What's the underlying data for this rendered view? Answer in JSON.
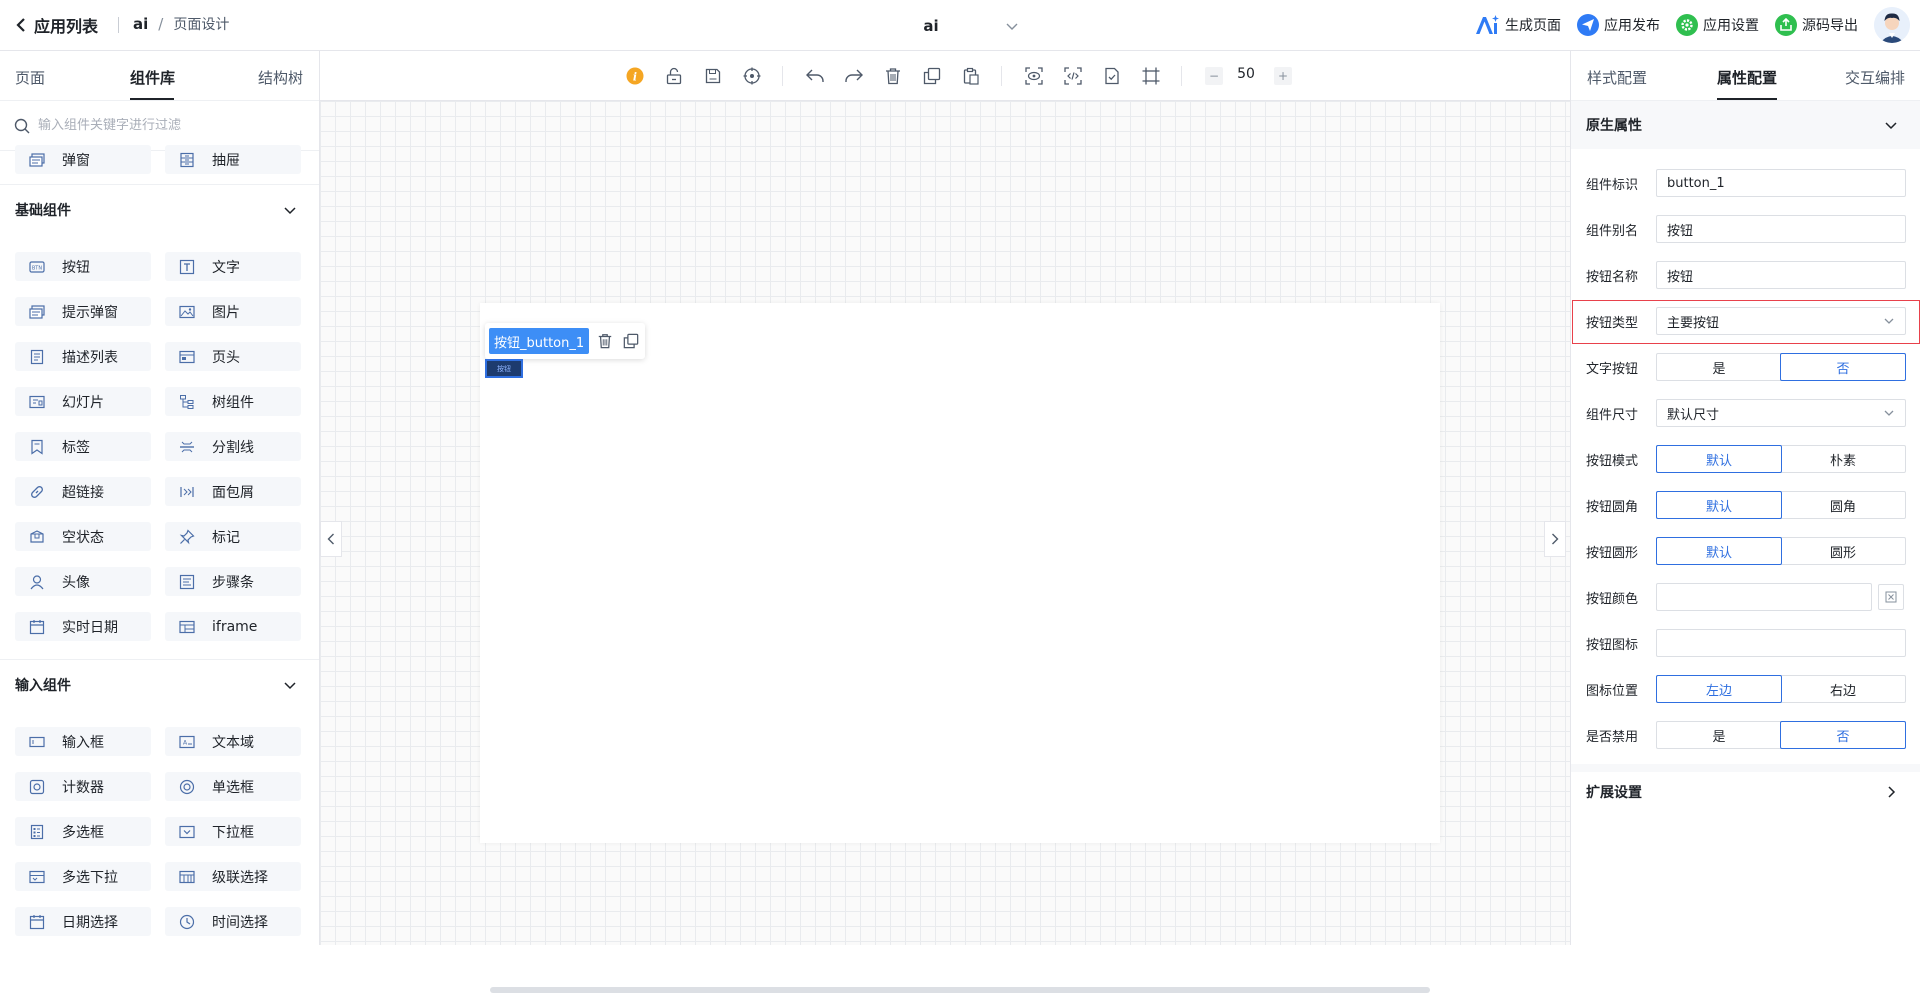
{
  "header": {
    "back_label": "应用列表",
    "app_name": "ai",
    "separator": "/",
    "page_label": "页面设计",
    "current_page": "ai",
    "actions": [
      {
        "label": "生成页面",
        "icon": "ai-icon"
      },
      {
        "label": "应用发布",
        "icon": "send-icon",
        "color": "#2f7bf5"
      },
      {
        "label": "应用设置",
        "icon": "settings-icon",
        "color": "#2fbf4f"
      },
      {
        "label": "源码导出",
        "icon": "export-icon",
        "color": "#2fbf4f"
      }
    ]
  },
  "left_panel": {
    "tabs": [
      "页面",
      "组件库",
      "结构树"
    ],
    "active_tab": "组件库",
    "search_placeholder": "输入组件关键字进行过滤",
    "top_items": [
      {
        "label": "弹窗",
        "icon": "modal-icon"
      },
      {
        "label": "抽屉",
        "icon": "drawer-icon"
      }
    ],
    "groups": [
      {
        "title": "基础组件",
        "items": [
          {
            "label": "按钮",
            "icon": "button-icon"
          },
          {
            "label": "文字",
            "icon": "text-icon"
          },
          {
            "label": "提示弹窗",
            "icon": "toast-icon"
          },
          {
            "label": "图片",
            "icon": "image-icon"
          },
          {
            "label": "描述列表",
            "icon": "description-icon"
          },
          {
            "label": "页头",
            "icon": "page-header-icon"
          },
          {
            "label": "幻灯片",
            "icon": "carousel-icon"
          },
          {
            "label": "树组件",
            "icon": "tree-icon"
          },
          {
            "label": "标签",
            "icon": "tag-icon"
          },
          {
            "label": "分割线",
            "icon": "divider-icon"
          },
          {
            "label": "超链接",
            "icon": "link-icon"
          },
          {
            "label": "面包屑",
            "icon": "breadcrumb-icon"
          },
          {
            "label": "空状态",
            "icon": "empty-icon"
          },
          {
            "label": "标记",
            "icon": "pin-icon"
          },
          {
            "label": "头像",
            "icon": "avatar-icon"
          },
          {
            "label": "步骤条",
            "icon": "steps-icon"
          },
          {
            "label": "实时日期",
            "icon": "calendar-icon"
          },
          {
            "label": "iframe",
            "icon": "iframe-icon"
          }
        ]
      },
      {
        "title": "输入组件",
        "items": [
          {
            "label": "输入框",
            "icon": "input-icon"
          },
          {
            "label": "文本域",
            "icon": "textarea-icon"
          },
          {
            "label": "计数器",
            "icon": "counter-icon"
          },
          {
            "label": "单选框",
            "icon": "radio-icon"
          },
          {
            "label": "多选框",
            "icon": "checkbox-icon"
          },
          {
            "label": "下拉框",
            "icon": "select-icon"
          },
          {
            "label": "多选下拉",
            "icon": "multi-select-icon"
          },
          {
            "label": "级联选择",
            "icon": "cascader-icon"
          },
          {
            "label": "日期选择",
            "icon": "date-picker-icon"
          },
          {
            "label": "时间选择",
            "icon": "time-picker-icon"
          }
        ]
      }
    ]
  },
  "toolbar": {
    "zoom_minus": "−",
    "zoom_value": "50",
    "zoom_plus": "+"
  },
  "canvas": {
    "selected_tag": "按钮_button_1",
    "button_text": "按钮"
  },
  "right_panel": {
    "tabs": [
      "样式配置",
      "属性配置",
      "交互编排"
    ],
    "active_tab": "属性配置",
    "section_native": "原生属性",
    "section_extend": "扩展设置",
    "props": {
      "component_id": {
        "label": "组件标识",
        "value": "button_1"
      },
      "alias": {
        "label": "组件别名",
        "value": "按钮"
      },
      "name": {
        "label": "按钮名称",
        "value": "按钮"
      },
      "type": {
        "label": "按钮类型",
        "value": "主要按钮"
      },
      "text_button": {
        "label": "文字按钮",
        "options": [
          "是",
          "否"
        ],
        "selected": "否"
      },
      "size": {
        "label": "组件尺寸",
        "value": "默认尺寸"
      },
      "mode": {
        "label": "按钮模式",
        "options": [
          "默认",
          "朴素"
        ],
        "selected": "默认"
      },
      "round": {
        "label": "按钮圆角",
        "options": [
          "默认",
          "圆角"
        ],
        "selected": "默认"
      },
      "circle": {
        "label": "按钮圆形",
        "options": [
          "默认",
          "圆形"
        ],
        "selected": "默认"
      },
      "color": {
        "label": "按钮颜色",
        "value": ""
      },
      "icon": {
        "label": "按钮图标",
        "value": ""
      },
      "icon_position": {
        "label": "图标位置",
        "options": [
          "左边",
          "右边"
        ],
        "selected": "左边"
      },
      "disabled": {
        "label": "是否禁用",
        "options": [
          "是",
          "否"
        ],
        "selected": "否"
      }
    }
  },
  "colors": {
    "accent": "#2f6fe0",
    "selection": "#3d8ef6",
    "highlight": "#e8414b",
    "warning": "#f5a623"
  }
}
